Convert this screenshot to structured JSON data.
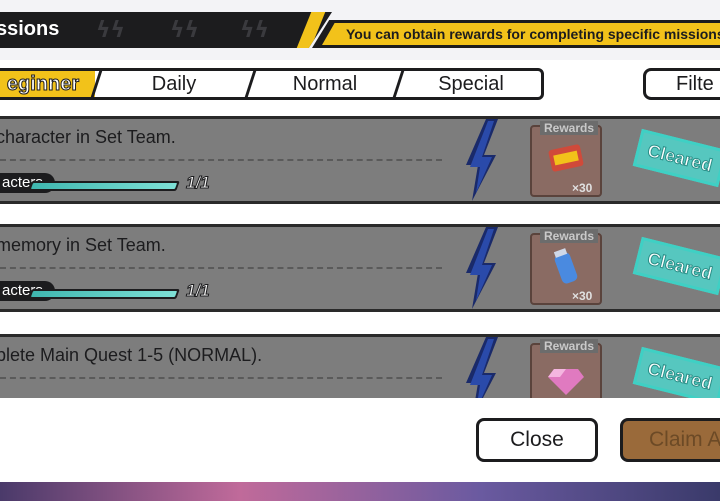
{
  "header": {
    "title": "ssions",
    "subtitle": "You can obtain rewards for completing specific missions"
  },
  "tabs": [
    {
      "label": "eginner",
      "active": true
    },
    {
      "label": "Daily",
      "active": false
    },
    {
      "label": "Normal",
      "active": false
    },
    {
      "label": "Special",
      "active": false
    }
  ],
  "filter_label": "Filte",
  "missions": [
    {
      "text": "character in Set Team.",
      "category": "acters",
      "progress_text": "1/1",
      "progress_fraction": 1.0,
      "reward_label": "Rewards",
      "reward_count": "×30",
      "reward_icon": "ticket-icon",
      "status": "Cleared"
    },
    {
      "text": "memory in Set Team.",
      "category": "acters",
      "progress_text": "1/1",
      "progress_fraction": 1.0,
      "reward_label": "Rewards",
      "reward_count": "×30",
      "reward_icon": "potion-bottle-icon",
      "status": "Cleared"
    },
    {
      "text": "plete Main Quest 1-5 (NORMAL).",
      "reward_label": "Rewards",
      "reward_icon": "gem-icon",
      "status": "Cleared"
    }
  ],
  "footer": {
    "close_label": "Close",
    "claim_label": "Claim A"
  },
  "colors": {
    "accent_yellow": "#f2c21a",
    "dark": "#1c1c1e",
    "cleared_teal": "#56c7bf",
    "progress_teal": "#3fb7b0",
    "reward_bg": "#8a6b63",
    "claim_disabled": "#9a6a3a"
  }
}
